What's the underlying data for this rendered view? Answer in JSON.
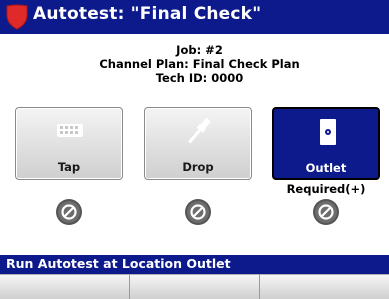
{
  "window": {
    "title": "Autotest: \"Final Check\"",
    "shield_color": "#e02a2a",
    "title_bar_color": "#0d1a8c"
  },
  "info": {
    "job": "Job: #2",
    "channel_plan": "Channel Plan: Final Check Plan",
    "tech_id": "Tech ID: 0000"
  },
  "locations": [
    {
      "label": "Tap",
      "icon": "tap-icon",
      "selected": false,
      "status_icon": "not-tested-icon"
    },
    {
      "label": "Drop",
      "icon": "drop-connector-icon",
      "selected": false,
      "status_icon": "not-tested-icon"
    },
    {
      "label": "Outlet",
      "icon": "outlet-icon",
      "selected": true,
      "status_icon": "not-tested-icon"
    }
  ],
  "outlet_required": "Required(+)",
  "status_bar": {
    "message": "Run Autotest at Location Outlet"
  },
  "softkeys": [
    {
      "label": ""
    },
    {
      "label": ""
    },
    {
      "label": ""
    }
  ]
}
